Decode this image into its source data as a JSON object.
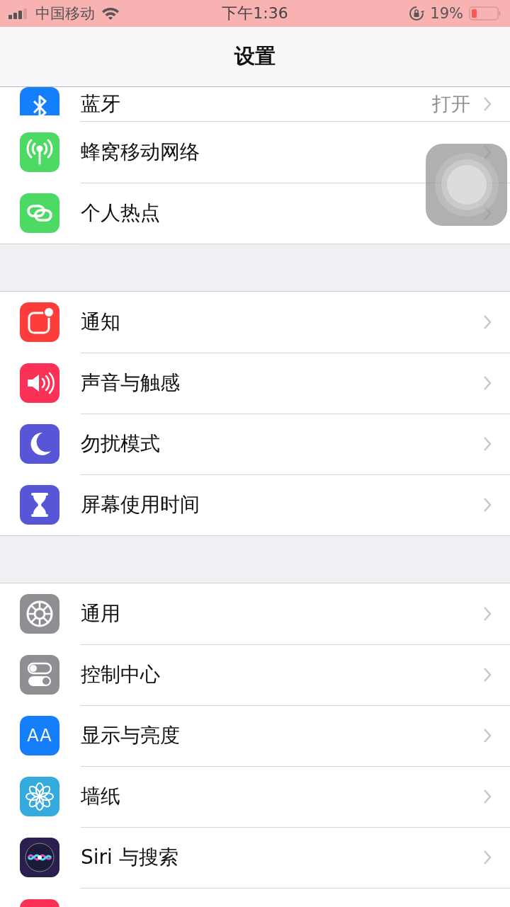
{
  "status_bar": {
    "carrier": "中国移动",
    "time": "下午1:36",
    "battery": "19%"
  },
  "title": "设置",
  "groups": [
    {
      "items": [
        {
          "kind": "bluetooth",
          "label": "蓝牙",
          "value": "打开",
          "partial": true
        },
        {
          "kind": "cellular",
          "label": "蜂窝移动网络",
          "partial": false
        },
        {
          "kind": "hotspot",
          "label": "个人热点",
          "partial": false
        }
      ]
    },
    {
      "items": [
        {
          "kind": "notifications",
          "label": "通知",
          "partial": false
        },
        {
          "kind": "sounds",
          "label": "声音与触感",
          "partial": false
        },
        {
          "kind": "dnd",
          "label": "勿扰模式",
          "partial": false
        },
        {
          "kind": "screentime",
          "label": "屏幕使用时间",
          "partial": false
        }
      ]
    },
    {
      "items": [
        {
          "kind": "general",
          "label": "通用",
          "partial": false
        },
        {
          "kind": "control",
          "label": "控制中心",
          "partial": false
        },
        {
          "kind": "display",
          "label": "显示与亮度",
          "icon_text": "AA",
          "partial": false
        },
        {
          "kind": "wallpaper",
          "label": "墙纸",
          "partial": false
        },
        {
          "kind": "siri",
          "label": "Siri 与搜索",
          "partial": false
        }
      ]
    }
  ]
}
